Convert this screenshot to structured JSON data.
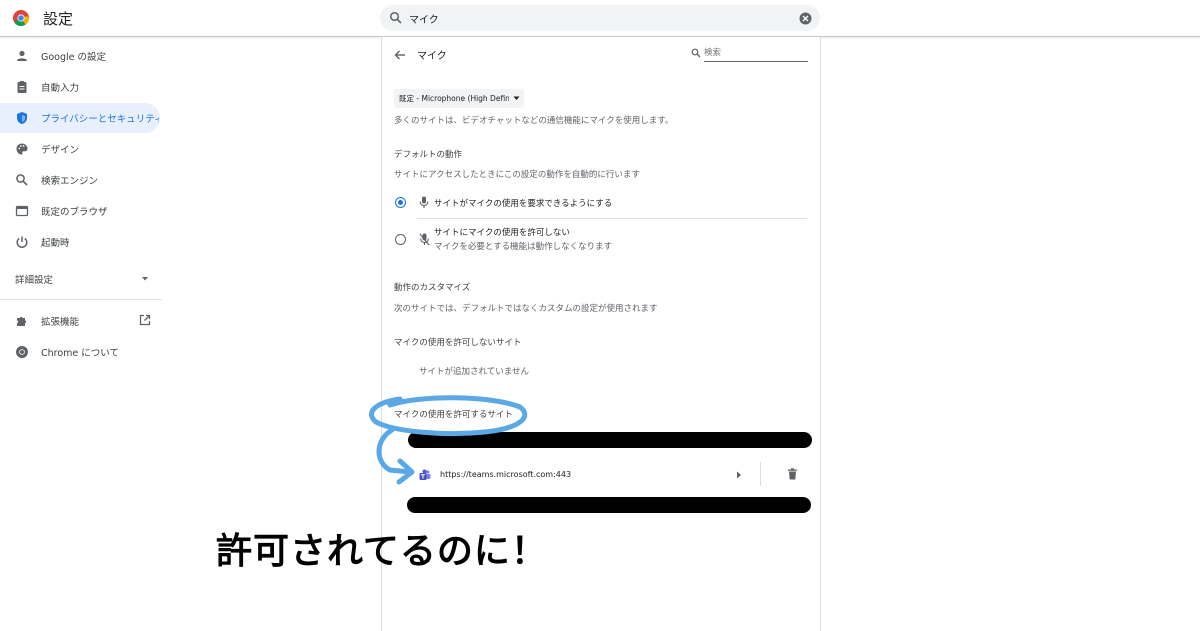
{
  "header": {
    "title": "設定",
    "search_value": "マイク"
  },
  "sidebar": {
    "items": [
      {
        "label": "Google の設定",
        "icon": "person-icon"
      },
      {
        "label": "自動入力",
        "icon": "clipboard-icon"
      },
      {
        "label": "プライバシーとセキュリティ",
        "icon": "shield-icon"
      },
      {
        "label": "デザイン",
        "icon": "palette-icon"
      },
      {
        "label": "検索エンジン",
        "icon": "search-icon"
      },
      {
        "label": "既定のブラウザ",
        "icon": "browser-icon"
      },
      {
        "label": "起動時",
        "icon": "power-icon"
      }
    ],
    "advanced_label": "詳細設定",
    "extensions_label": "拡張機能",
    "about_label": "Chrome について"
  },
  "main": {
    "subpage_title": "マイク",
    "search_placeholder": "検索",
    "mic_select": "既定 - Microphone (High Defin",
    "description": "多くのサイトは、ビデオチャットなどの通信機能にマイクを使用します。",
    "default_behavior": {
      "heading": "デフォルトの動作",
      "subtitle": "サイトにアクセスしたときにこの設定の動作を自動的に行います",
      "options": [
        {
          "label": "サイトがマイクの使用を要求できるようにする",
          "sublabel": "",
          "checked": true
        },
        {
          "label": "サイトにマイクの使用を許可しない",
          "sublabel": "マイクを必要とする機能は動作しなくなります",
          "checked": false
        }
      ]
    },
    "custom": {
      "heading": "動作のカスタマイズ",
      "subtitle": "次のサイトでは、デフォルトではなくカスタムの設定が使用されます"
    },
    "blocked": {
      "heading": "マイクの使用を許可しないサイト",
      "empty": "サイトが追加されていません"
    },
    "allowed": {
      "heading": "マイクの使用を許可するサイト",
      "sites": [
        {
          "url": "https://teams.microsoft.com:443",
          "icon": "teams-icon"
        }
      ]
    }
  },
  "annotation": {
    "text": "許可されてるのに！",
    "color": "#5aa8e6"
  },
  "colors": {
    "accent": "#1a73e8",
    "active_bg": "#e8f0fe"
  }
}
